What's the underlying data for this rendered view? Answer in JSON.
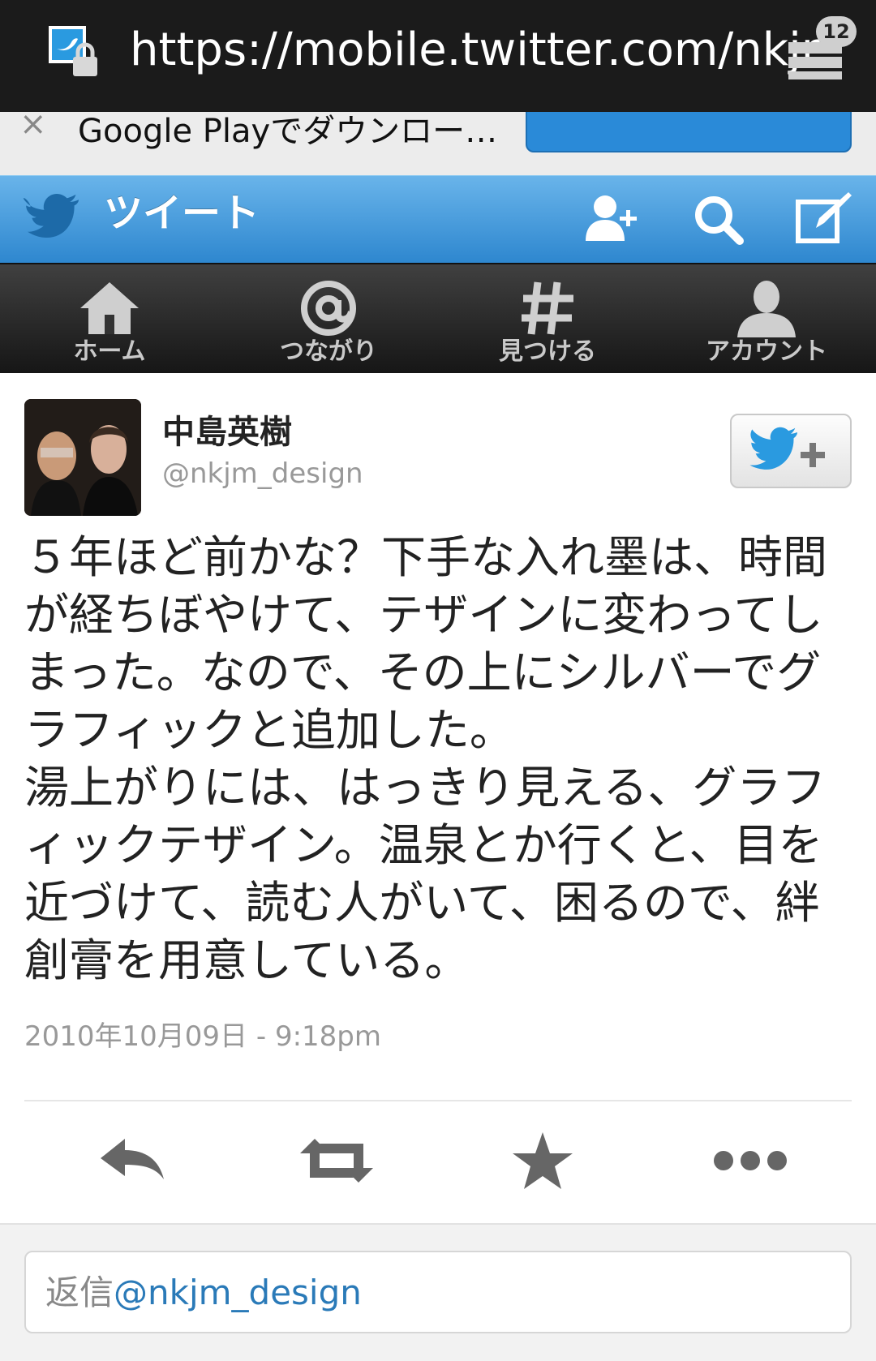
{
  "browser": {
    "url": "https://mobile.twitter.com/nkjr",
    "tab_count": "12"
  },
  "banner": {
    "text": "Google Playでダウンロー…"
  },
  "header": {
    "title": "ツイート"
  },
  "nav": {
    "items": [
      {
        "label": "ホーム",
        "icon": "home-icon"
      },
      {
        "label": "つながり",
        "icon": "at-icon"
      },
      {
        "label": "見つける",
        "icon": "hash-icon"
      },
      {
        "label": "アカウント",
        "icon": "person-icon"
      }
    ]
  },
  "tweet": {
    "name": "中島英樹",
    "handle": "@nkjm_design",
    "text": "５年ほど前かな？下手な入れ墨は、時間が経ちぼやけて、テザインに変わってしまった。なので、その上にシルバーでグラフィックと追加した。\n湯上がりには、はっきり見える、グラフィックテザイン。温泉とか行くと、目を近づけて、読む人がいて、困るので、絆創膏を用意している。",
    "timestamp": "2010年10月09日 - 9:18pm"
  },
  "reply": {
    "prefix": "返信",
    "mention": "@nkjm_design"
  },
  "colors": {
    "header_blue": "#2e87cf",
    "navbar_dark": "#161616",
    "link_blue": "#2a7ab8"
  }
}
